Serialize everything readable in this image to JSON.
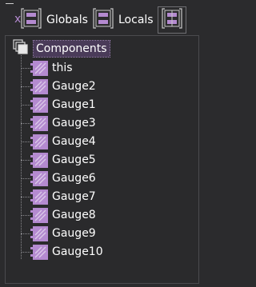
{
  "tabs": {
    "globals_label": "Globals",
    "locals_label": "Locals"
  },
  "tree": {
    "root_label": "Components",
    "items": [
      {
        "label": "this"
      },
      {
        "label": "Gauge2"
      },
      {
        "label": "Gauge1"
      },
      {
        "label": "Gauge3"
      },
      {
        "label": "Gauge4"
      },
      {
        "label": "Gauge5"
      },
      {
        "label": "Gauge6"
      },
      {
        "label": "Gauge7"
      },
      {
        "label": "Gauge8"
      },
      {
        "label": "Gauge9"
      },
      {
        "label": "Gauge10"
      }
    ]
  },
  "colors": {
    "background": "#2b2b2d",
    "accent_purple": "#b48ad0",
    "selection": "#4a3b59",
    "text": "#ffffff"
  },
  "icons": {
    "globals": "globals-x-icon",
    "locals": "locals-frame-icon",
    "third": "watch-frame-icon",
    "root": "components-stack-icon",
    "item": "component-icon"
  }
}
